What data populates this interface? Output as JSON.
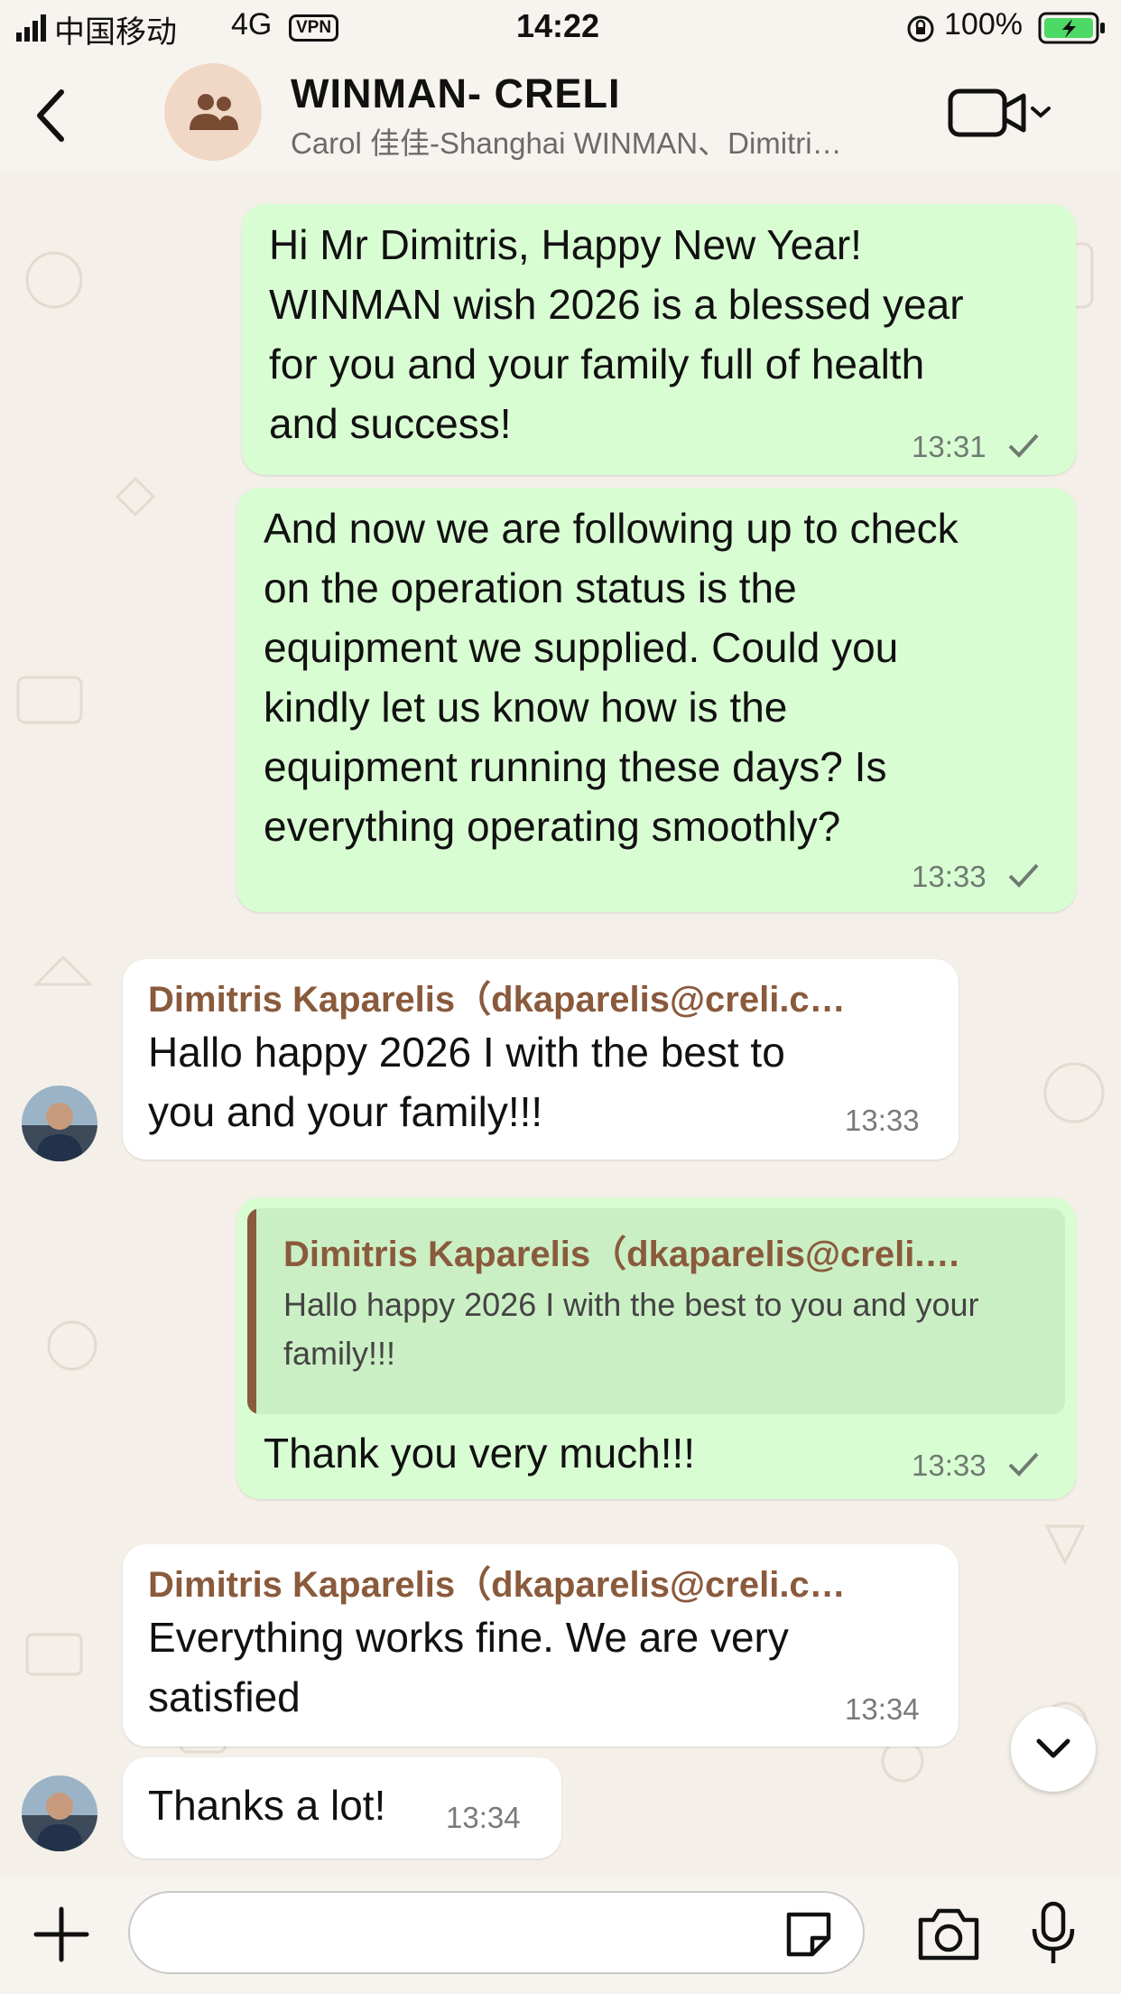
{
  "status_bar": {
    "carrier": "中国移动",
    "network": "4G",
    "vpn": "VPN",
    "time": "14:22",
    "battery": "100%"
  },
  "header": {
    "title": "WINMAN- CRELI",
    "subtitle": "Carol 佳佳-Shanghai WINMAN、Dimitri…",
    "back_icon": "chevron-left-icon",
    "group_icon": "group-icon",
    "video_icon": "video-camera-icon"
  },
  "messages": [
    {
      "direction": "out",
      "text": "Hi Mr Dimitris, Happy New Year!\nWINMAN wish 2026 is a blessed year\nfor you and your family full of health\nand success!",
      "time": "13:31",
      "status": "sent"
    },
    {
      "direction": "out",
      "text": "And now we are following up to check\non the operation status is the\nequipment we supplied. Could you\nkindly let us know how is the\nequipment running these days? Is\neverything operating smoothly?",
      "time": "13:33",
      "status": "sent"
    },
    {
      "direction": "in",
      "sender": "Dimitris Kaparelis（dkaparelis@creli.c…",
      "text": "Hallo happy 2026 I with the best to\nyou and your family!!!",
      "time": "13:33"
    },
    {
      "direction": "out",
      "quote_sender": "Dimitris Kaparelis（dkaparelis@creli.…",
      "quote_text": "Hallo happy 2026 I with the best to you and\nyour family!!!",
      "text": "Thank you very much!!!",
      "time": "13:33",
      "status": "sent"
    },
    {
      "direction": "in",
      "sender": "Dimitris Kaparelis（dkaparelis@creli.c…",
      "text": "Everything works fine. We are very\nsatisfied",
      "time": "13:34"
    },
    {
      "direction": "in",
      "text": "Thanks a lot!",
      "time": "13:34"
    }
  ],
  "composer": {
    "placeholder": "",
    "plus_icon": "plus-icon",
    "sticker_icon": "sticker-icon",
    "camera_icon": "camera-icon",
    "mic_icon": "microphone-icon"
  },
  "colors": {
    "outgoing_bubble": "#d9fdd3",
    "incoming_bubble": "#ffffff",
    "sender_name": "#8a5a3c",
    "background": "#f4efe8"
  }
}
